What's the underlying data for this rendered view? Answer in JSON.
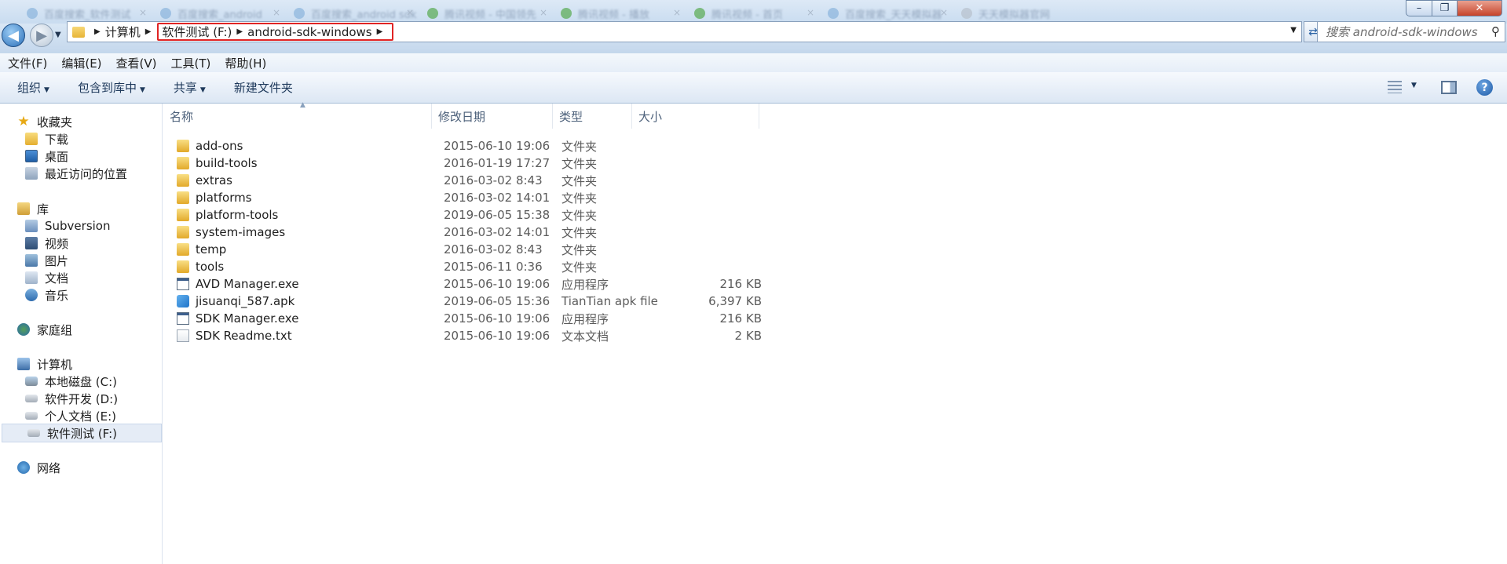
{
  "window": {
    "tabs": [
      {
        "label": "百度搜索_软件测试"
      },
      {
        "label": "百度搜索_android"
      },
      {
        "label": "百度搜索_android sdk"
      },
      {
        "label": "腾讯视频 - 中国领先"
      },
      {
        "label": "腾讯视频 - 播放"
      },
      {
        "label": "腾讯视频 - 首页"
      },
      {
        "label": "百度搜索_天天模拟器"
      },
      {
        "label": "天天模拟器官网"
      }
    ],
    "controls": {
      "minimize": "–",
      "maximize": "❐",
      "close": "✕"
    }
  },
  "navigation": {
    "back_glyph": "◀",
    "forward_glyph": "▶",
    "breadcrumbs": [
      "计算机",
      "软件测试 (F:)",
      "android-sdk-windows"
    ],
    "search_placeholder": "搜索 android-sdk-windows"
  },
  "menu": [
    "文件(F)",
    "编辑(E)",
    "查看(V)",
    "工具(T)",
    "帮助(H)"
  ],
  "commands": {
    "organize": "组织",
    "include_in_library": "包含到库中",
    "share": "共享",
    "new_folder": "新建文件夹"
  },
  "sidebar": {
    "favorites": {
      "label": "收藏夹",
      "items": [
        "下载",
        "桌面",
        "最近访问的位置"
      ]
    },
    "libraries": {
      "label": "库",
      "items": [
        "Subversion",
        "视频",
        "图片",
        "文档",
        "音乐"
      ]
    },
    "homegroup": {
      "label": "家庭组"
    },
    "computer": {
      "label": "计算机",
      "items": [
        "本地磁盘 (C:)",
        "软件开发 (D:)",
        "个人文档 (E:)",
        "软件测试 (F:)"
      ]
    },
    "network": {
      "label": "网络"
    },
    "selected": "软件测试 (F:)"
  },
  "columns": {
    "name": "名称",
    "date": "修改日期",
    "type": "类型",
    "size": "大小"
  },
  "files": [
    {
      "name": "add-ons",
      "date": "2015-06-10 19:06",
      "type": "文件夹",
      "size": "",
      "icon": "folder-icon"
    },
    {
      "name": "build-tools",
      "date": "2016-01-19 17:27",
      "type": "文件夹",
      "size": "",
      "icon": "folder-icon"
    },
    {
      "name": "extras",
      "date": "2016-03-02 8:43",
      "type": "文件夹",
      "size": "",
      "icon": "folder-icon"
    },
    {
      "name": "platforms",
      "date": "2016-03-02 14:01",
      "type": "文件夹",
      "size": "",
      "icon": "folder-icon"
    },
    {
      "name": "platform-tools",
      "date": "2019-06-05 15:38",
      "type": "文件夹",
      "size": "",
      "icon": "folder-icon"
    },
    {
      "name": "system-images",
      "date": "2016-03-02 14:01",
      "type": "文件夹",
      "size": "",
      "icon": "folder-icon"
    },
    {
      "name": "temp",
      "date": "2016-03-02 8:43",
      "type": "文件夹",
      "size": "",
      "icon": "folder-icon"
    },
    {
      "name": "tools",
      "date": "2015-06-11 0:36",
      "type": "文件夹",
      "size": "",
      "icon": "folder-icon"
    },
    {
      "name": "AVD Manager.exe",
      "date": "2015-06-10 19:06",
      "type": "应用程序",
      "size": "216 KB",
      "icon": "exe-icon"
    },
    {
      "name": "jisuanqi_587.apk",
      "date": "2019-06-05 15:36",
      "type": "TianTian apk file",
      "size": "6,397 KB",
      "icon": "apk-icon"
    },
    {
      "name": "SDK Manager.exe",
      "date": "2015-06-10 19:06",
      "type": "应用程序",
      "size": "216 KB",
      "icon": "exe-icon"
    },
    {
      "name": "SDK Readme.txt",
      "date": "2015-06-10 19:06",
      "type": "文本文档",
      "size": "2 KB",
      "icon": "text-file-icon"
    }
  ],
  "colors": {
    "highlight_border": "#e02424",
    "accent": "#2a6fb8",
    "selection": "#e5ecf6"
  }
}
